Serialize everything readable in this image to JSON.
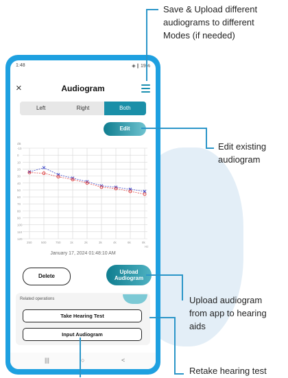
{
  "status_bar": {
    "time": "1:48",
    "icons": "✉ ✓",
    "right": "◈ ∥ 19%"
  },
  "app_bar": {
    "title": "Audiogram"
  },
  "ear_tabs": [
    "Left",
    "Right",
    "Both"
  ],
  "active_tab": "Both",
  "edit_label": "Edit",
  "chart_data": {
    "type": "line",
    "y_unit_label": "dB",
    "x_unit_label": "Hz",
    "y_ticks": [
      "-10",
      "0",
      "10",
      "20",
      "30",
      "40",
      "50",
      "60",
      "70",
      "80",
      "90",
      "100",
      "110",
      "120"
    ],
    "x_ticks": [
      "250",
      "500",
      "750",
      "1k",
      "2k",
      "3k",
      "4k",
      "6k",
      "8k"
    ],
    "ylim": [
      -10,
      120
    ],
    "series": [
      {
        "marker": "x",
        "color": "#3a45c8",
        "values": [
          24,
          18,
          28,
          33,
          38,
          44,
          46,
          49,
          52
        ]
      },
      {
        "marker": "o",
        "color": "#e04848",
        "values": [
          25,
          26,
          31,
          35,
          40,
          46,
          48,
          52,
          56
        ]
      }
    ]
  },
  "audiogram_date": "January 17, 2024 01:48:10 AM",
  "delete_label": "Delete",
  "upload_label_line1": "Upload",
  "upload_label_line2": "Audiogram",
  "related_label": "Related operations",
  "take_test_label": "Take Hearing Test",
  "input_label": "Input Audiogram",
  "nav": {
    "recent": "|||",
    "home": "○",
    "back": "<"
  },
  "annotations": {
    "save": [
      "Save & Upload different",
      "audiograms to different",
      "Modes (if needed)"
    ],
    "edit": [
      "Edit existing",
      "audiogram"
    ],
    "upload": [
      "Upload audiogram",
      "from app to hearing",
      "aids"
    ],
    "retake": "Retake hearing test"
  },
  "colors": {
    "phone": "#1ea0e0",
    "accent": "#1a8fa8",
    "callout_line": "#2a95c8"
  }
}
